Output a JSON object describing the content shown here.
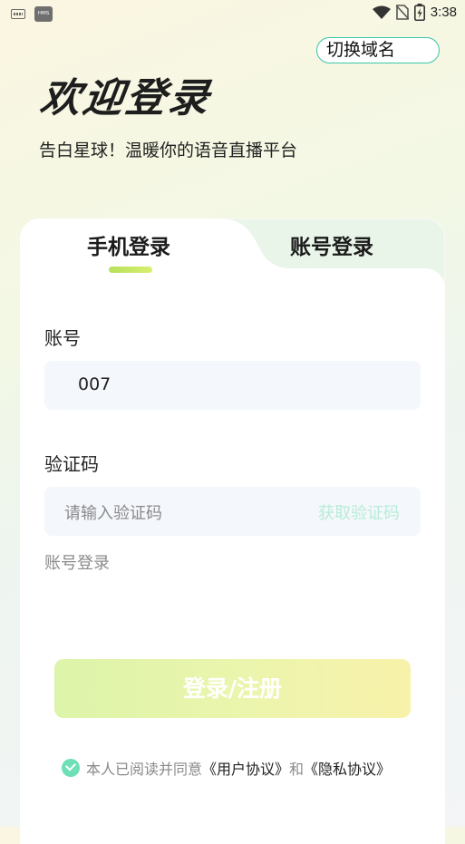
{
  "status_bar": {
    "time": "3:38",
    "hms_label": "HMS"
  },
  "header": {
    "switch_domain": "切换域名",
    "welcome": "欢迎登录",
    "subtitle": "告白星球！温暖你的语音直播平台"
  },
  "tabs": {
    "phone": "手机登录",
    "account": "账号登录",
    "active": "phone"
  },
  "form": {
    "account_label": "账号",
    "account_value": "007",
    "code_label": "验证码",
    "code_placeholder": "请输入验证码",
    "get_code": "获取验证码",
    "switch_account_login": "账号登录"
  },
  "login_button": "登录/注册",
  "agreement": {
    "prefix": "本人已阅读并同意",
    "user_agreement": "《用户协议》",
    "and": "和",
    "privacy_agreement": "《隐私协议》",
    "checked": true
  },
  "colors": {
    "accent_green": "#39c6a8",
    "check_green": "#6ee0b7",
    "get_code_color": "#b8ecd8",
    "field_bg": "#f4f7fb"
  }
}
